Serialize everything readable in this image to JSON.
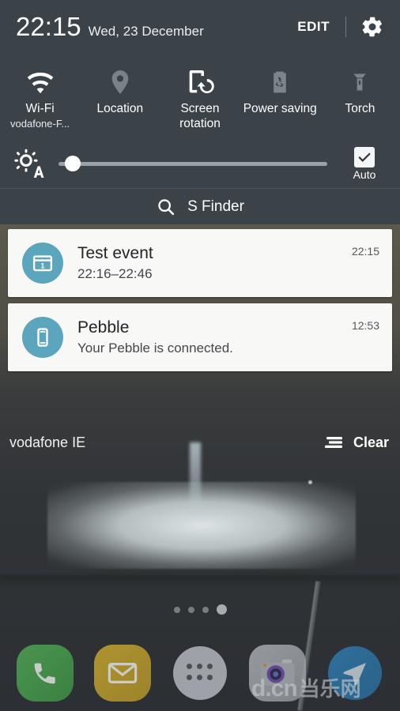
{
  "status_header": {
    "clock": "22:15",
    "date": "Wed, 23 December",
    "edit_label": "EDIT",
    "gear_icon": "gear-icon"
  },
  "quick_settings": {
    "toggles": [
      {
        "label": "Wi-Fi",
        "sub": "vodafone-F...",
        "icon": "wifi-icon",
        "state": "on"
      },
      {
        "label": "Location",
        "sub": "",
        "icon": "location-pin-icon",
        "state": "off"
      },
      {
        "label": "Screen rotation",
        "sub": "",
        "icon": "screen-rotation-icon",
        "state": "on"
      },
      {
        "label": "Power saving",
        "sub": "",
        "icon": "power-saving-icon",
        "state": "off"
      },
      {
        "label": "Torch",
        "sub": "",
        "icon": "torch-icon",
        "state": "off"
      }
    ]
  },
  "brightness": {
    "icon": "auto-brightness-icon",
    "value_percent": 3,
    "auto_label": "Auto",
    "auto_checked": true
  },
  "search": {
    "label": "S Finder",
    "icon": "search-icon"
  },
  "notifications": [
    {
      "app_icon": "calendar-icon",
      "title": "Test event",
      "body": "22:16–22:46",
      "time": "22:15",
      "accent": "#5ba5bd"
    },
    {
      "app_icon": "smartphone-icon",
      "title": "Pebble",
      "body": "Your Pebble is connected.",
      "time": "12:53",
      "accent": "#5ba5bd"
    }
  ],
  "footer": {
    "carrier": "vodafone IE",
    "clear_label": "Clear",
    "clear_icon": "clear-lines-icon"
  },
  "home_screen": {
    "page_dots": {
      "count": 4,
      "active_index": 3
    },
    "dock": [
      {
        "label": "Phone",
        "icon": "phone-icon",
        "color": "#52ae57"
      },
      {
        "label": "Email",
        "icon": "envelope-icon",
        "color": "#cfae2e"
      },
      {
        "label": "Apps",
        "icon": "apps-grid-icon",
        "color": "#b7bcc2"
      },
      {
        "label": "Camera",
        "icon": "camera-icon",
        "color": "#a0a5ab"
      },
      {
        "label": "Navigation",
        "icon": "navigation-icon",
        "color": "#2f7fb4"
      }
    ]
  },
  "watermark": {
    "latin": "d.cn",
    "cn": "当乐网"
  },
  "colors": {
    "shade_background": "#3b4349",
    "notification_card": "#f8f8f7",
    "accent_teal": "#5ba5bd",
    "icon_on": "#ffffff",
    "icon_off": "#7d858c"
  }
}
